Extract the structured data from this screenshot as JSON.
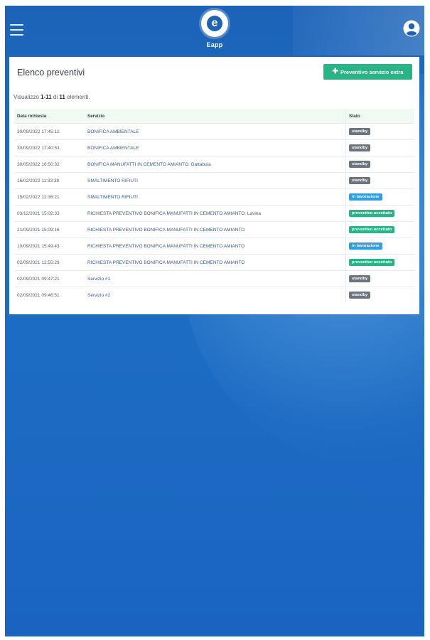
{
  "header": {
    "app_name": "Eapp",
    "logo_letter": "e",
    "menu_icon": "hamburger-menu-icon",
    "user_icon": "user-circle-icon"
  },
  "panel": {
    "title": "Elenco preventivi",
    "extra_button_label": "Preventivo servizio extra",
    "extra_button_icon": "plus-icon",
    "summary_prefix": "Visualizzo",
    "summary_range": "1-11",
    "summary_of": "di",
    "summary_total": "11",
    "summary_suffix": "elementi."
  },
  "table": {
    "columns": [
      "Data richiesta",
      "Servizio",
      "Stato"
    ],
    "rows": [
      {
        "date": "30/09/2022 17:45:12",
        "service": "BONIFICA AMBIENTALE",
        "status": "standby",
        "color": "#6c757d"
      },
      {
        "date": "30/09/2022 17:40:53",
        "service": "BONIFICA AMBIENTALE",
        "status": "standby",
        "color": "#6c757d"
      },
      {
        "date": "30/05/2022 16:50:32",
        "service": "BONIFICA MANUFATTI IN CEMENTO AMIANTO: Gattabuia",
        "status": "standby",
        "color": "#6c757d"
      },
      {
        "date": "16/02/2022 11:33:38",
        "service": "SMALTIMENTO RIFIUTI",
        "status": "standby",
        "color": "#6c757d"
      },
      {
        "date": "15/02/2022 12:36:21",
        "service": "SMALTIMENTO RIFIUTI",
        "status": "in lavorazione",
        "color": "#2f9ee8"
      },
      {
        "date": "03/12/2021 15:02:33",
        "service": "RICHIESTA PREVENTIVO BONIFICA MANUFATTI IN CEMENTO AMIANTO: Lavina",
        "status": "preventivo accettato",
        "color": "#28b486"
      },
      {
        "date": "21/09/2021 15:09:16",
        "service": "RICHIESTA PREVENTIVO BONIFICA MANUFATTI IN CEMENTO AMIANTO",
        "status": "preventivo accettato",
        "color": "#28b486"
      },
      {
        "date": "10/09/2021 15:49:43",
        "service": "RICHIESTA PREVENTIVO BONIFICA MANUFATTI IN CEMENTO AMIANTO",
        "status": "in lavorazione",
        "color": "#2f9ee8"
      },
      {
        "date": "02/09/2021 12:55:29",
        "service": "RICHIESTA PREVENTIVO BONIFICA MANUFATTI IN CEMENTO AMIANTO",
        "status": "preventivo accettato",
        "color": "#28b486"
      },
      {
        "date": "02/09/2021 09:47:21",
        "service": "Servizio #1",
        "status": "standby",
        "color": "#6c757d"
      },
      {
        "date": "02/09/2021 09:46:51",
        "service": "Servizio #2",
        "status": "standby",
        "color": "#6c757d"
      }
    ]
  }
}
